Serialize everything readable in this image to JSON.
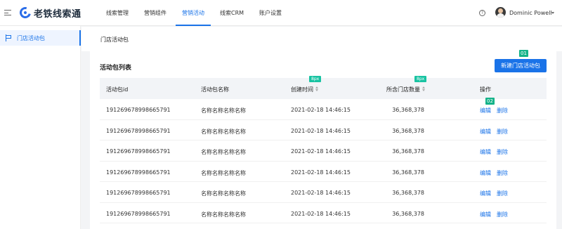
{
  "header": {
    "logo_text": "老铁线索通",
    "nav": [
      "线索管理",
      "营销组件",
      "营销活动",
      "线索CRM",
      "账户设置"
    ],
    "active_nav": "营销活动",
    "help_symbol": "?",
    "user_name": "Dominic Powell"
  },
  "sidebar": {
    "items": [
      {
        "label": "门店活动包",
        "active": true
      }
    ]
  },
  "page": {
    "title": "门店活动包"
  },
  "card": {
    "title": "活动包列表",
    "new_button": "新建门店活动包"
  },
  "table": {
    "columns": [
      "活动包id",
      "活动包名称",
      "创建时间",
      "所含门店数量",
      "操作"
    ],
    "rows": [
      {
        "id": "191269678998665791",
        "name": "名称名称名称名称",
        "created": "2021-02-18 14:46:15",
        "stores": "36,368,378",
        "edit": "编辑",
        "delete": "删除"
      },
      {
        "id": "191269678998665791",
        "name": "名称名称名称名称",
        "created": "2021-02-18 14:46:15",
        "stores": "36,368,378",
        "edit": "编辑",
        "delete": "删除"
      },
      {
        "id": "191269678998665791",
        "name": "名称名称名称名称",
        "created": "2021-02-18 14:46:15",
        "stores": "36,368,378",
        "edit": "编辑",
        "delete": "删除"
      },
      {
        "id": "191269678998665791",
        "name": "名称名称名称名称",
        "created": "2021-02-18 14:46:15",
        "stores": "36,368,378",
        "edit": "编辑",
        "delete": "删除"
      },
      {
        "id": "191269678998665791",
        "name": "名称名称名称名称",
        "created": "2021-02-18 14:46:15",
        "stores": "36,368,378",
        "edit": "编辑",
        "delete": "删除"
      },
      {
        "id": "191269678998665791",
        "name": "名称名称名称名称",
        "created": "2021-02-18 14:46:15",
        "stores": "36,368,378",
        "edit": "编辑",
        "delete": "删除"
      }
    ]
  },
  "annotations": {
    "spacing_badge_1": "8px",
    "spacing_badge_2": "8px",
    "marker_1": "01",
    "marker_2": "02"
  },
  "colors": {
    "primary": "#1a73e8",
    "annotation": "#18c3a2"
  }
}
